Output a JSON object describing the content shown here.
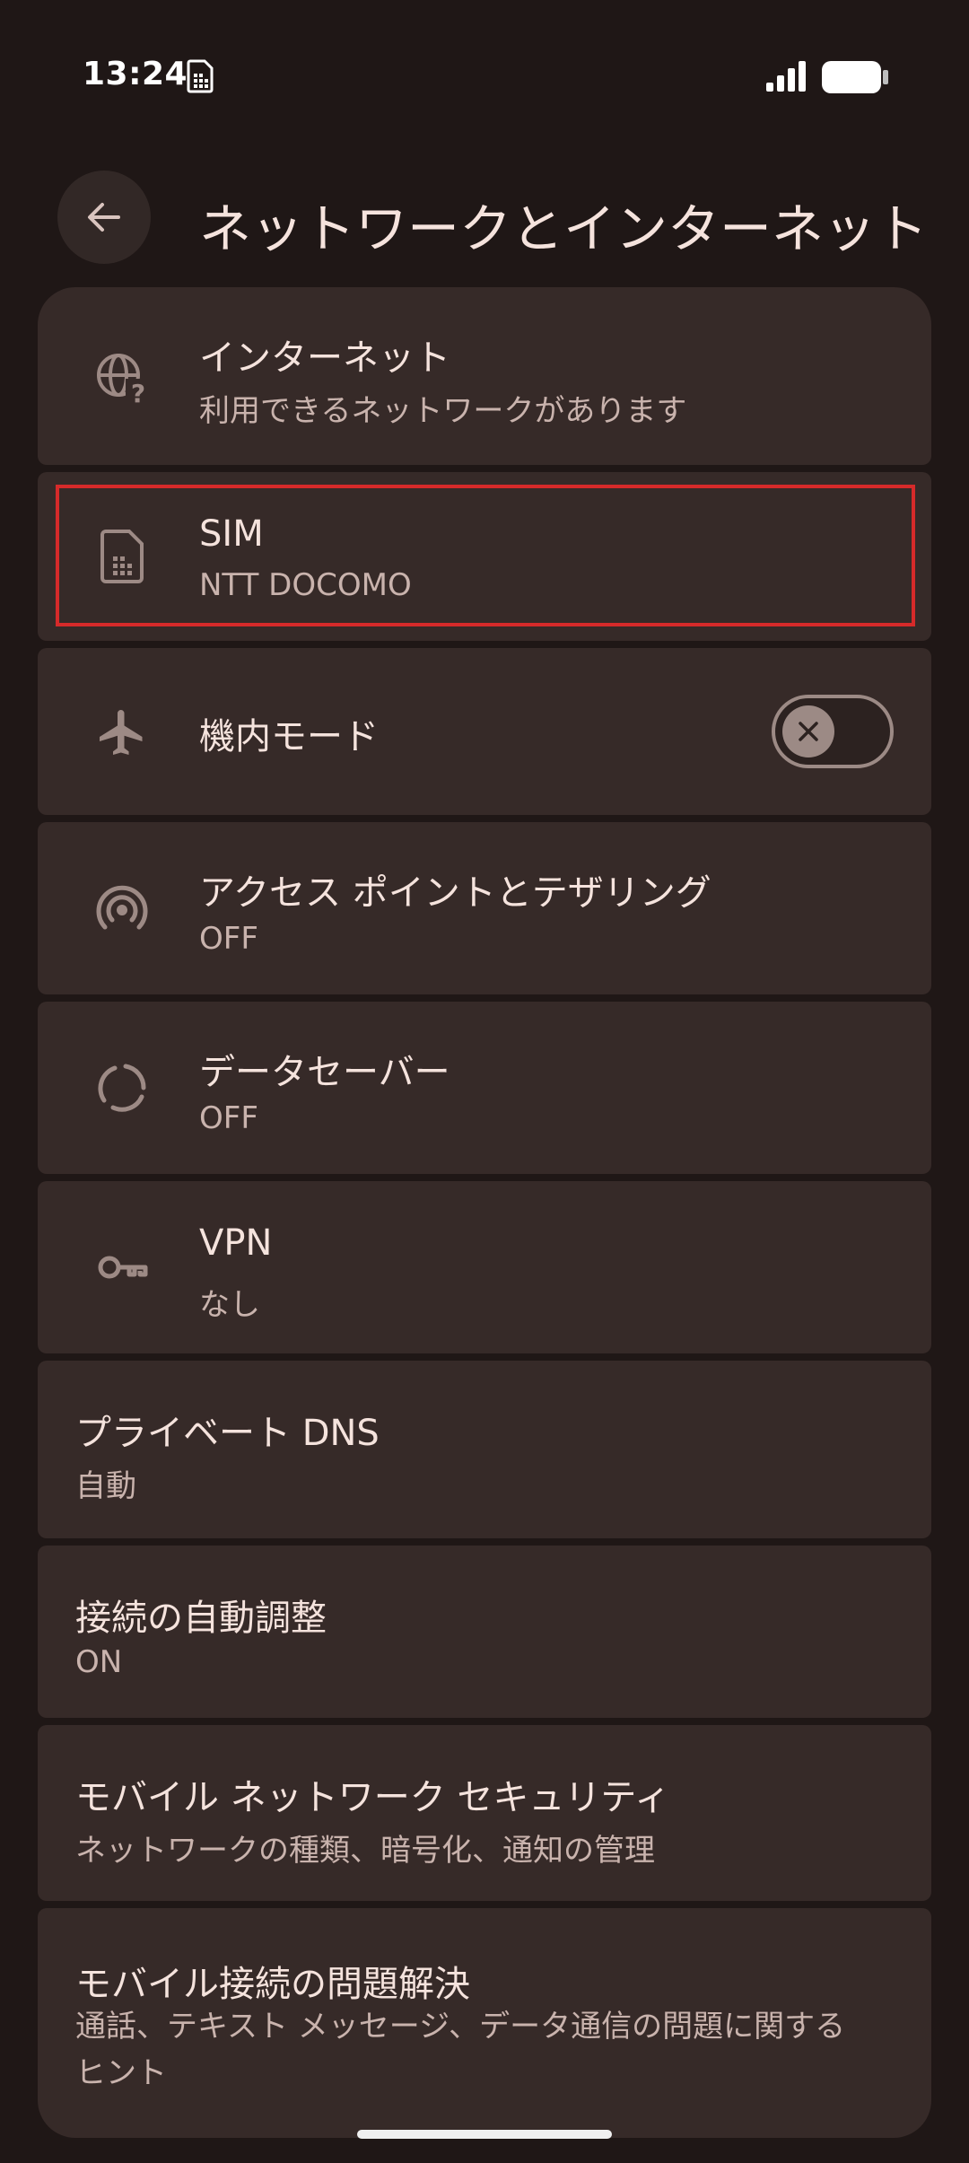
{
  "status_bar": {
    "time": "13:24"
  },
  "header": {
    "title": "ネットワークとインターネット",
    "back_icon": "arrow-back-icon"
  },
  "items": [
    {
      "title": "インターネット",
      "subtitle": "利用できるネットワークがあります",
      "icon": "globe-question-icon"
    },
    {
      "title": "SIM",
      "subtitle": "NTT DOCOMO",
      "icon": "sim-card-icon"
    },
    {
      "title": "機内モード",
      "icon": "airplane-icon",
      "toggle": "off"
    },
    {
      "title": "アクセス ポイントとテザリング",
      "subtitle": "OFF",
      "icon": "hotspot-icon"
    },
    {
      "title": "データセーバー",
      "subtitle": "OFF",
      "icon": "data-saver-icon"
    },
    {
      "title": "VPN",
      "subtitle": "なし",
      "icon": "vpn-key-icon"
    },
    {
      "title": "プライベート DNS",
      "subtitle": "自動"
    },
    {
      "title": "接続の自動調整",
      "subtitle": "ON"
    },
    {
      "title": "モバイル ネットワーク セキュリティ",
      "subtitle": "ネットワークの種類、暗号化、通知の管理"
    },
    {
      "title": "モバイル接続の問題解決",
      "subtitle": "通話、テキスト メッセージ、データ通信の問題に関するヒント"
    }
  ],
  "colors": {
    "background": "#1f1716",
    "card": "#362a28",
    "highlight": "#d62a2a"
  }
}
